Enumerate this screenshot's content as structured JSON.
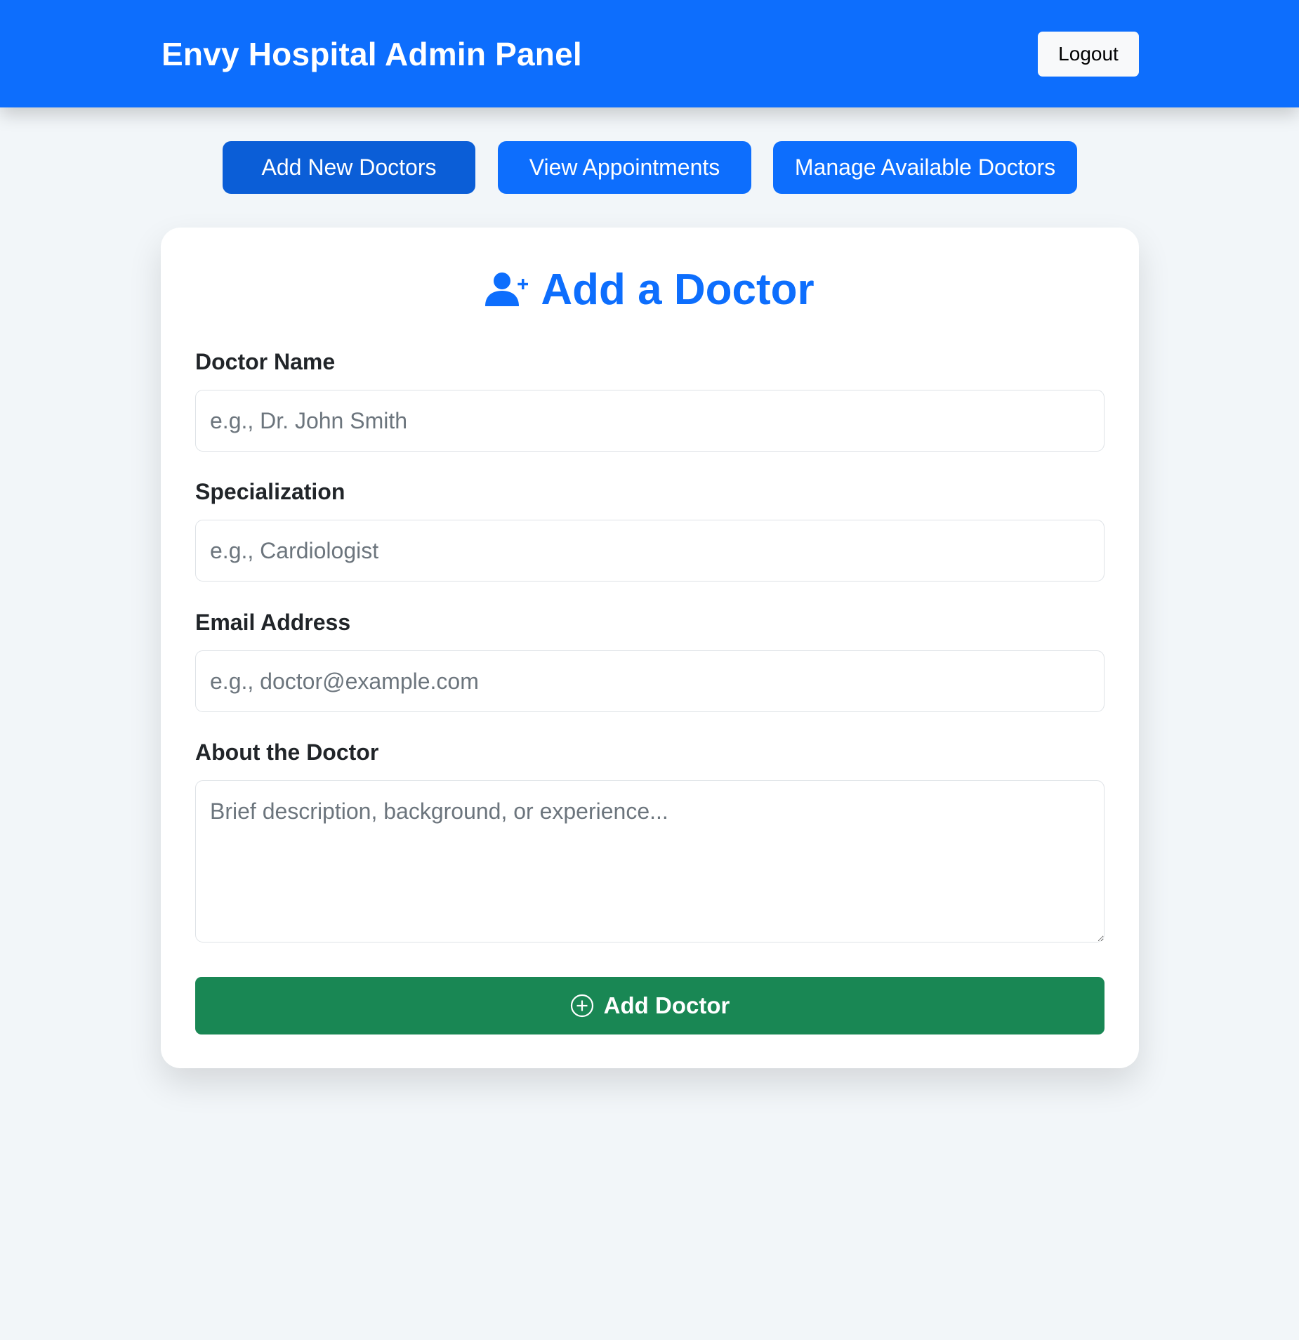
{
  "header": {
    "title": "Envy Hospital Admin Panel",
    "logout_label": "Logout"
  },
  "tabs": [
    {
      "label": "Add New Doctors",
      "active": true
    },
    {
      "label": "View Appointments",
      "active": false
    },
    {
      "label": "Manage Available Doctors",
      "active": false
    }
  ],
  "form": {
    "title": "Add a Doctor",
    "title_icon": "user-plus-icon",
    "fields": {
      "name": {
        "label": "Doctor Name",
        "placeholder": "e.g., Dr. John Smith",
        "value": ""
      },
      "specialization": {
        "label": "Specialization",
        "placeholder": "e.g., Cardiologist",
        "value": ""
      },
      "email": {
        "label": "Email Address",
        "placeholder": "e.g., doctor@example.com",
        "value": ""
      },
      "about": {
        "label": "About the Doctor",
        "placeholder": "Brief description, background, or experience...",
        "value": ""
      }
    },
    "submit_label": "Add Doctor",
    "submit_icon": "plus-circle-icon"
  },
  "colors": {
    "primary": "#0d6efd",
    "primary_active": "#0b5ed7",
    "success": "#198754",
    "background": "#f2f6f9"
  }
}
